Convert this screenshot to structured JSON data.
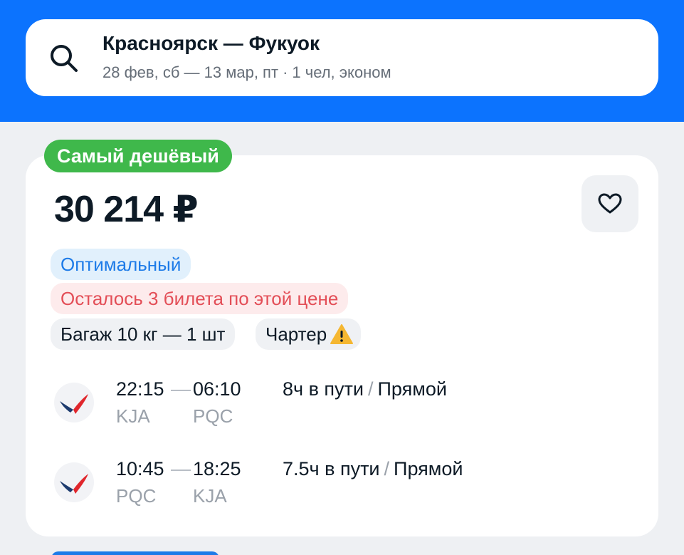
{
  "search": {
    "route": "Красноярск — Фукуок",
    "dates": "28 фев, сб — 13 мар, пт",
    "separator": "·",
    "passengers": "1 чел, эконом"
  },
  "ticket": {
    "badge": "Самый дешёвый",
    "price": "30 214 ₽",
    "tags": {
      "optimal": "Оптимальный",
      "tickets_left": "Осталось 3 билета по этой цене",
      "baggage": "Багаж 10 кг — 1 шт",
      "charter": "Чартер"
    },
    "segments": [
      {
        "dep_time": "22:15",
        "arr_time": "06:10",
        "dep_code": "KJA",
        "arr_code": "PQC",
        "duration": "8ч в пути",
        "slash": "/",
        "type": "Прямой"
      },
      {
        "dep_time": "10:45",
        "arr_time": "18:25",
        "dep_code": "PQC",
        "arr_code": "KJA",
        "duration": "7.5ч в пути",
        "slash": "/",
        "type": "Прямой"
      }
    ]
  },
  "colors": {
    "brand_blue": "#0c73fe",
    "badge_green": "#3fb84b",
    "optimal_blue": "#1d7be8",
    "alert_red": "#e34e57",
    "warning_yellow": "#f5b731"
  },
  "icons": {
    "search": "search-icon",
    "favorite": "heart-icon",
    "warning": "warning-icon",
    "airline": "airline-logo"
  }
}
